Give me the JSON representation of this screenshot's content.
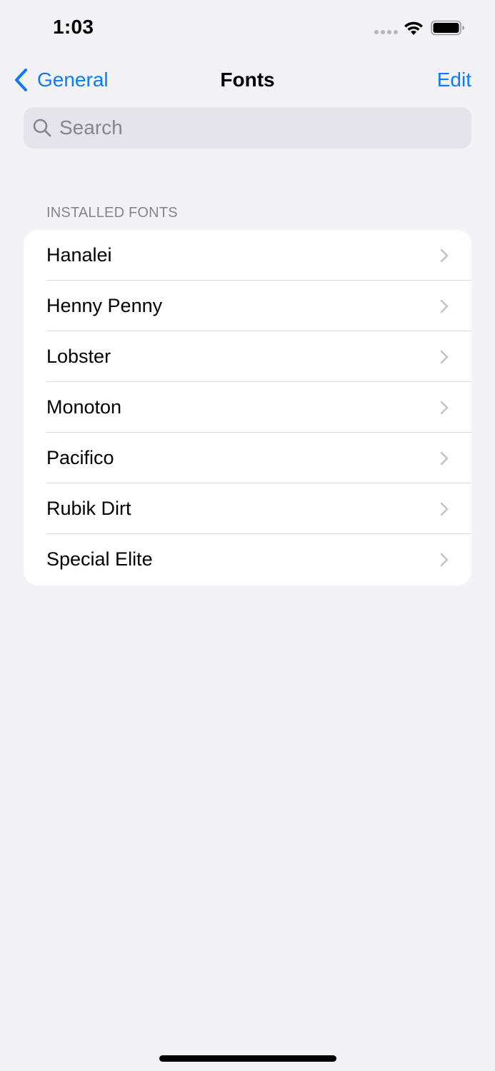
{
  "status_bar": {
    "time": "1:03"
  },
  "nav": {
    "back_label": "General",
    "title": "Fonts",
    "edit_label": "Edit"
  },
  "search": {
    "placeholder": "Search"
  },
  "installed_fonts": {
    "header": "INSTALLED FONTS",
    "items": [
      {
        "label": "Hanalei"
      },
      {
        "label": "Henny Penny"
      },
      {
        "label": "Lobster"
      },
      {
        "label": "Monoton"
      },
      {
        "label": "Pacifico"
      },
      {
        "label": "Rubik Dirt"
      },
      {
        "label": "Special Elite"
      }
    ]
  },
  "colors": {
    "accent": "#0a7aff",
    "background": "#f2f2f7",
    "search_background": "#e4e4ea",
    "secondary_text": "#84848a"
  },
  "icons": {
    "back": "chevron-left-icon",
    "search": "search-icon",
    "row": "chevron-right-icon",
    "wifi": "wifi-icon",
    "battery": "battery-icon"
  }
}
